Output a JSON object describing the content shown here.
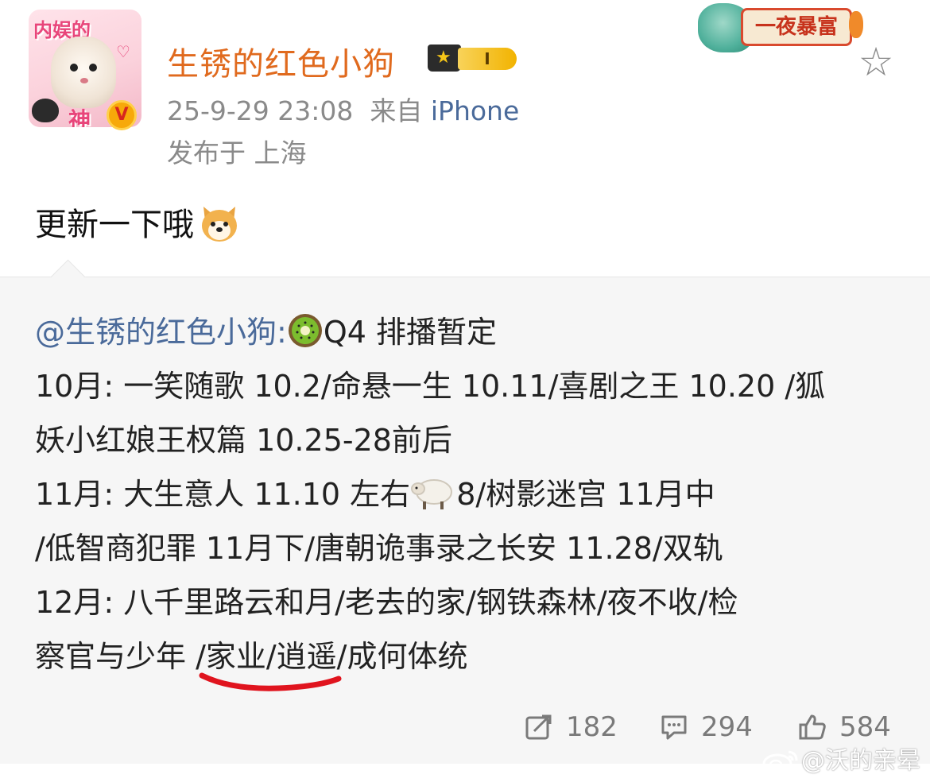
{
  "header": {
    "username": "生锈的红色小狗",
    "avatar_top_text": "内娱的",
    "avatar_bottom_text": "神",
    "verified_badge": "V",
    "level_badge": "I",
    "timestamp": "25-9-29 23:08",
    "from_label": "来自",
    "device": "iPhone",
    "location": "发布于 上海",
    "promo_banner": "一夜暴富",
    "favorite_icon": "star-outline-icon"
  },
  "post": {
    "text": "更新一下哦",
    "emoji": "dog-face-emoji"
  },
  "repost": {
    "mention": "@生锈的红色小狗:",
    "kiwi_emoji": "kiwi-emoji",
    "title": "Q4 排播暂定",
    "line2": "10月: 一笑随歌 10.2/命悬一生 10.11/喜剧之王 10.20 /狐",
    "line3": "妖小红娘王权篇 10.25-28前后",
    "line4a": "11月: 大生意人 11.10 左右",
    "sheep_emoji": "sheep-emoji",
    "line4b": "8/树影迷宫 11月中",
    "line5": "/低智商犯罪 11月下/唐朝诡事录之长安 11.28/双轨",
    "line6": "12月: 八千里路云和月/老去的家/钢铁森林/夜不收/检",
    "line7": "察官与少年 /家业/逍遥/成何体统"
  },
  "actions": {
    "repost_count": "182",
    "comment_count": "294",
    "like_count": "584"
  },
  "watermark": {
    "text": "@沃的亲晕"
  },
  "colors": {
    "username": "#e06a1e",
    "link": "#4a6a9a",
    "meta": "#8a8a8a",
    "repost_bg": "#f6f6f6",
    "underline_mark": "#e0141e"
  }
}
